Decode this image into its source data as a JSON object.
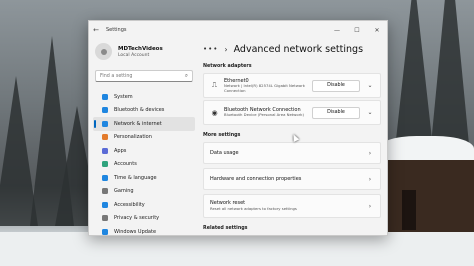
{
  "window": {
    "title": "Settings"
  },
  "account": {
    "name": "MDTechVideos",
    "type": "Local Account"
  },
  "search": {
    "placeholder": "Find a setting"
  },
  "sidebar": {
    "items": [
      {
        "label": "System",
        "color": "#1f86e0"
      },
      {
        "label": "Bluetooth & devices",
        "color": "#1f86e0"
      },
      {
        "label": "Network & internet",
        "color": "#1f86e0"
      },
      {
        "label": "Personalization",
        "color": "#e37b2b"
      },
      {
        "label": "Apps",
        "color": "#5b6bd6"
      },
      {
        "label": "Accounts",
        "color": "#2fa37d"
      },
      {
        "label": "Time & language",
        "color": "#1f86e0"
      },
      {
        "label": "Gaming",
        "color": "#777777"
      },
      {
        "label": "Accessibility",
        "color": "#1f86e0"
      },
      {
        "label": "Privacy & security",
        "color": "#777777"
      },
      {
        "label": "Windows Update",
        "color": "#1f86e0"
      }
    ],
    "active_index": 2
  },
  "content": {
    "breadcrumb_more": "•••",
    "title": "Advanced network settings",
    "network_adapters_label": "Network adapters",
    "adapters": [
      {
        "name": "Ethernet0",
        "description": "Network | Intel(R) 82574L Gigabit Network Connection",
        "button": "Disable",
        "icon": "ethernet-icon"
      },
      {
        "name": "Bluetooth Network Connection",
        "description": "Bluetooth Device (Personal Area Network)",
        "button": "Disable",
        "icon": "bluetooth-icon"
      }
    ],
    "more_settings_label": "More settings",
    "more_settings": [
      {
        "label": "Data usage",
        "description": ""
      },
      {
        "label": "Hardware and connection properties",
        "description": ""
      },
      {
        "label": "Network reset",
        "description": "Reset all network adapters to factory settings"
      }
    ],
    "related_settings_label": "Related settings"
  },
  "colors": {
    "accent": "#0067c0"
  }
}
